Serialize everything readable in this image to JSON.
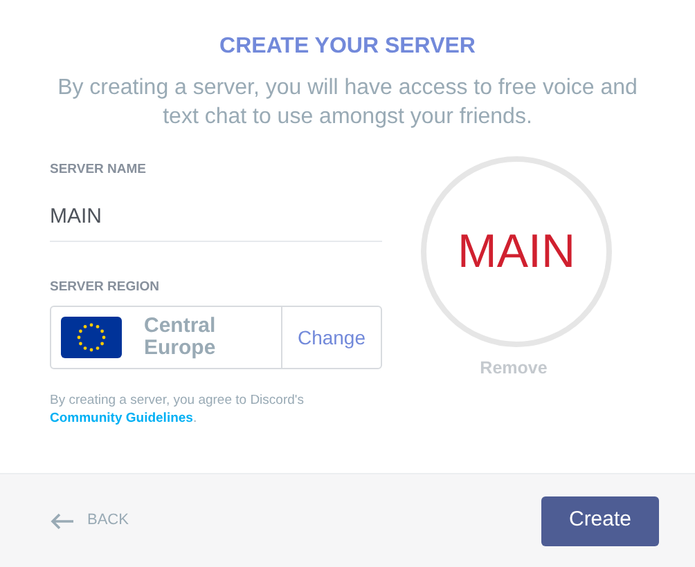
{
  "title": "CREATE YOUR SERVER",
  "subtitle": "By creating a server, you will have access to free voice and text chat to use amongst your friends.",
  "server_name": {
    "label": "SERVER NAME",
    "value": "MAIN"
  },
  "server_region": {
    "label": "SERVER REGION",
    "region": "Central Europe",
    "action": "Change"
  },
  "terms": {
    "text": "By creating a server, you agree to Discord's",
    "link": "Community Guidelines",
    "suffix": "."
  },
  "icon_preview": {
    "text": "MAIN",
    "action": "Remove"
  },
  "footer": {
    "back": "BACK",
    "create": "Create"
  }
}
